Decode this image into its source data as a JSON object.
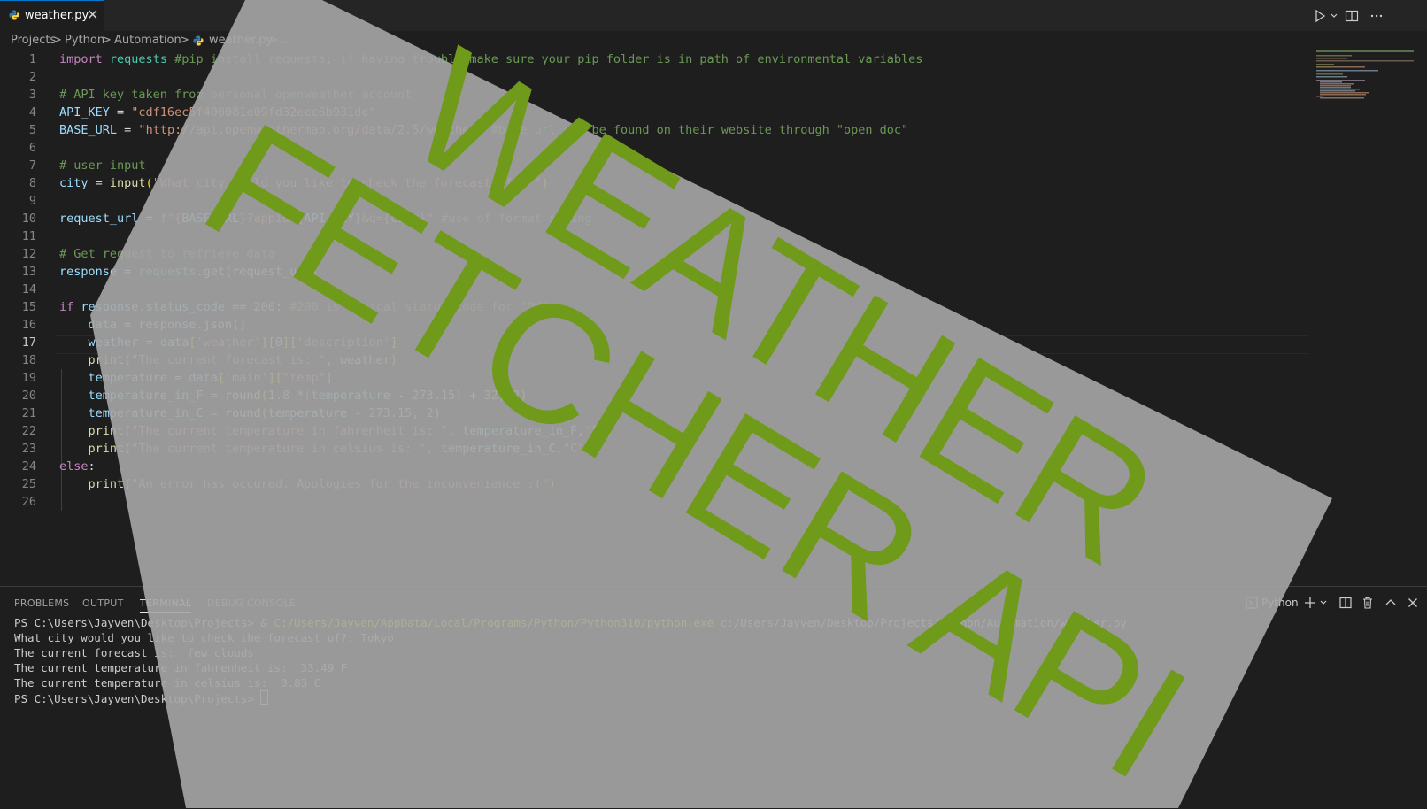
{
  "tab": {
    "filename": "weather.py",
    "close_glyph": "✕"
  },
  "breadcrumb": {
    "parts": [
      "Projects",
      "Python",
      "Automation",
      "weather.py"
    ],
    "separator": ">",
    "ellipsis": "..."
  },
  "editor": {
    "current_line": 17,
    "lines": [
      {
        "n": "1"
      },
      {
        "n": "2"
      },
      {
        "n": "3"
      },
      {
        "n": "4"
      },
      {
        "n": "5"
      },
      {
        "n": "6"
      },
      {
        "n": "7"
      },
      {
        "n": "8"
      },
      {
        "n": "9"
      },
      {
        "n": "10"
      },
      {
        "n": "11"
      },
      {
        "n": "12"
      },
      {
        "n": "13"
      },
      {
        "n": "14"
      },
      {
        "n": "15"
      },
      {
        "n": "16"
      },
      {
        "n": "17"
      },
      {
        "n": "18"
      },
      {
        "n": "19"
      },
      {
        "n": "20"
      },
      {
        "n": "21"
      },
      {
        "n": "22"
      },
      {
        "n": "23"
      },
      {
        "n": "24"
      },
      {
        "n": "25"
      },
      {
        "n": "26"
      }
    ],
    "code": {
      "l1_kw": "import",
      "l1_mod": "requests",
      "l1_com": "#pip install requests; if having trouble make sure your pip folder is in path of environmental variables",
      "l3_com": "# API key taken from personal openweather account",
      "l4_var": "API_KEY",
      "l4_str": "\"cdf16ec5f400081e09fd32ecc6b931dc\"",
      "l5_var": "BASE_URL",
      "l5_url": "http://api.openweathermap.org/data/2.5/weather",
      "l5_com": "#base url can be found on their website through \"open doc\"",
      "l7_com": "# user input",
      "l8_var": "city",
      "l8_fn": "input",
      "l8_str": "\"What city would you like to check the forecast of?: \"",
      "l10_var": "request_url",
      "l10_f": "f\"",
      "l10_a": "BASE_URL",
      "l10_b": "?appid=",
      "l10_c": "API_KEY",
      "l10_d": "&q=",
      "l10_e": "city",
      "l10_com": "#use of format string",
      "l12_com": "# Get request to retrieve data",
      "l13_var": "response",
      "l13_mod": "requests",
      "l13_fn": "get",
      "l13_arg": "request_url",
      "l15_kw": "if",
      "l15_a": "response",
      "l15_b": "status_code",
      "l15_num": "200",
      "l15_com": "#200 is typical status code for \"OK\"",
      "l16_var": "data",
      "l16_a": "response",
      "l16_fn": "json",
      "l17_var": "weather",
      "l17_a": "data",
      "l17_s1": "'weather'",
      "l17_n": "0",
      "l17_s2": "'description'",
      "l18_fn": "print",
      "l18_str": "\"The current forecast is: \"",
      "l18_var": "weather",
      "l19_var": "temperature",
      "l19_a": "data",
      "l19_s1": "'main'",
      "l19_s2": "\"temp\"",
      "l20_var": "temperature_in_F",
      "l20_fn": "round",
      "l20_n1": "1.8",
      "l20_v": "temperature",
      "l20_n2": "273.15",
      "l20_n3": "32",
      "l20_n4": "2",
      "l21_var": "temperature_in_C",
      "l21_fn": "round",
      "l21_v": "temperature",
      "l21_n1": "273.15",
      "l21_n2": "2",
      "l22_fn": "print",
      "l22_str": "\"The current temperature in fahrenheit is: \"",
      "l22_var": "temperature_in_F",
      "l22_s2": "\"F\"",
      "l23_fn": "print",
      "l23_str": "\"The current temperature in celsius is: \"",
      "l23_var": "temperature_in_C",
      "l23_s2": "\"C\"",
      "l24_kw": "else",
      "l25_fn": "print",
      "l25_str": "\"An error has occured. Apologies for the inconvenience :(\""
    }
  },
  "panel": {
    "tabs": [
      "PROBLEMS",
      "OUTPUT",
      "TERMINAL",
      "DEBUG CONSOLE"
    ],
    "active_tab": "TERMINAL",
    "shell_label": "Python"
  },
  "terminal": {
    "l1_prompt": "PS C:\\Users\\Jayven\\Desktop\\Projects> & ",
    "l1_exe": "C:/Users/Jayven/AppData/Local/Programs/Python/Python310/python.exe",
    "l1_arg": " c:/Users/Jayven/Desktop/Projects/Python/Automation/weather.py",
    "l2": "What city would you like to check the forecast of?: Tokyo",
    "l3": "The current forecast is:  few clouds",
    "l4": "The current temperature in fahrenheit is:  33.49 F",
    "l5": "The current temperature in celsius is:  0.83 C",
    "l6": "PS C:\\Users\\Jayven\\Desktop\\Projects> "
  },
  "overlay": {
    "line1": "WEATHER",
    "line2": "FETCHER API",
    "band_color": "#a6a6a6",
    "text_color": "#6f9a1a"
  },
  "colors": {
    "editor_bg": "#1e1e1e",
    "tabbar_bg": "#252526",
    "accent": "#007acc"
  }
}
